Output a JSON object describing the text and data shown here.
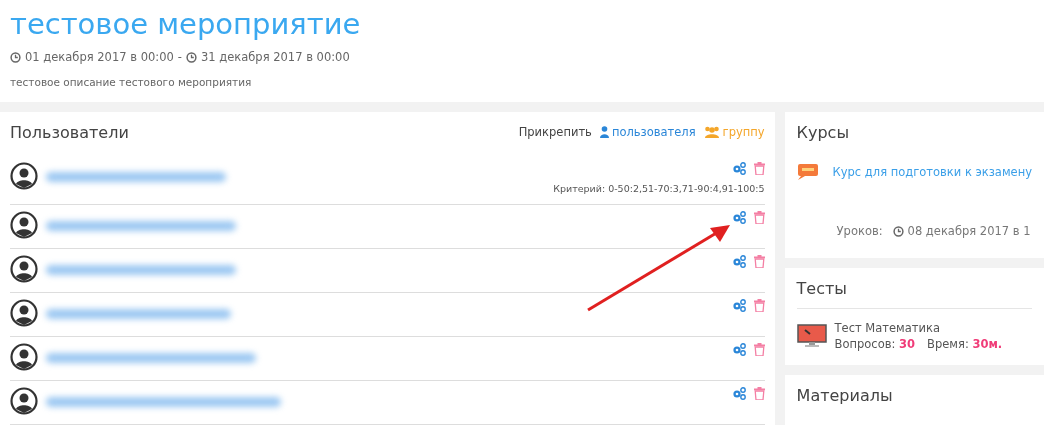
{
  "event": {
    "title": "тестовое мероприятие",
    "start": "01 декабря 2017 в 00:00",
    "separator": "-",
    "end": "31 декабря 2017 в 00:00",
    "description": "тестовое описание тестового мероприятия"
  },
  "users": {
    "title": "Пользователи",
    "attach_label": "Прикрепить",
    "attach_user": "пользователя",
    "attach_group": "группу",
    "rows": [
      {
        "kind": "user",
        "criterion": "Критерий: 0-50:2,51-70:3,71-90:4,91-100:5"
      },
      {
        "kind": "user"
      },
      {
        "kind": "user"
      },
      {
        "kind": "user"
      },
      {
        "kind": "user"
      },
      {
        "kind": "user"
      }
    ]
  },
  "courses": {
    "title": "Курсы",
    "items": [
      {
        "name": "Курс для подготовки к экзамену",
        "lessons_label": "Уроков:",
        "date": "08 декабря 2017 в 1"
      }
    ]
  },
  "tests": {
    "title": "Тесты",
    "items": [
      {
        "name": "Тест Математика",
        "questions_label": "Вопросов:",
        "questions": "30",
        "time_label": "Время:",
        "time": "30м."
      }
    ]
  },
  "materials": {
    "title": "Материалы"
  }
}
